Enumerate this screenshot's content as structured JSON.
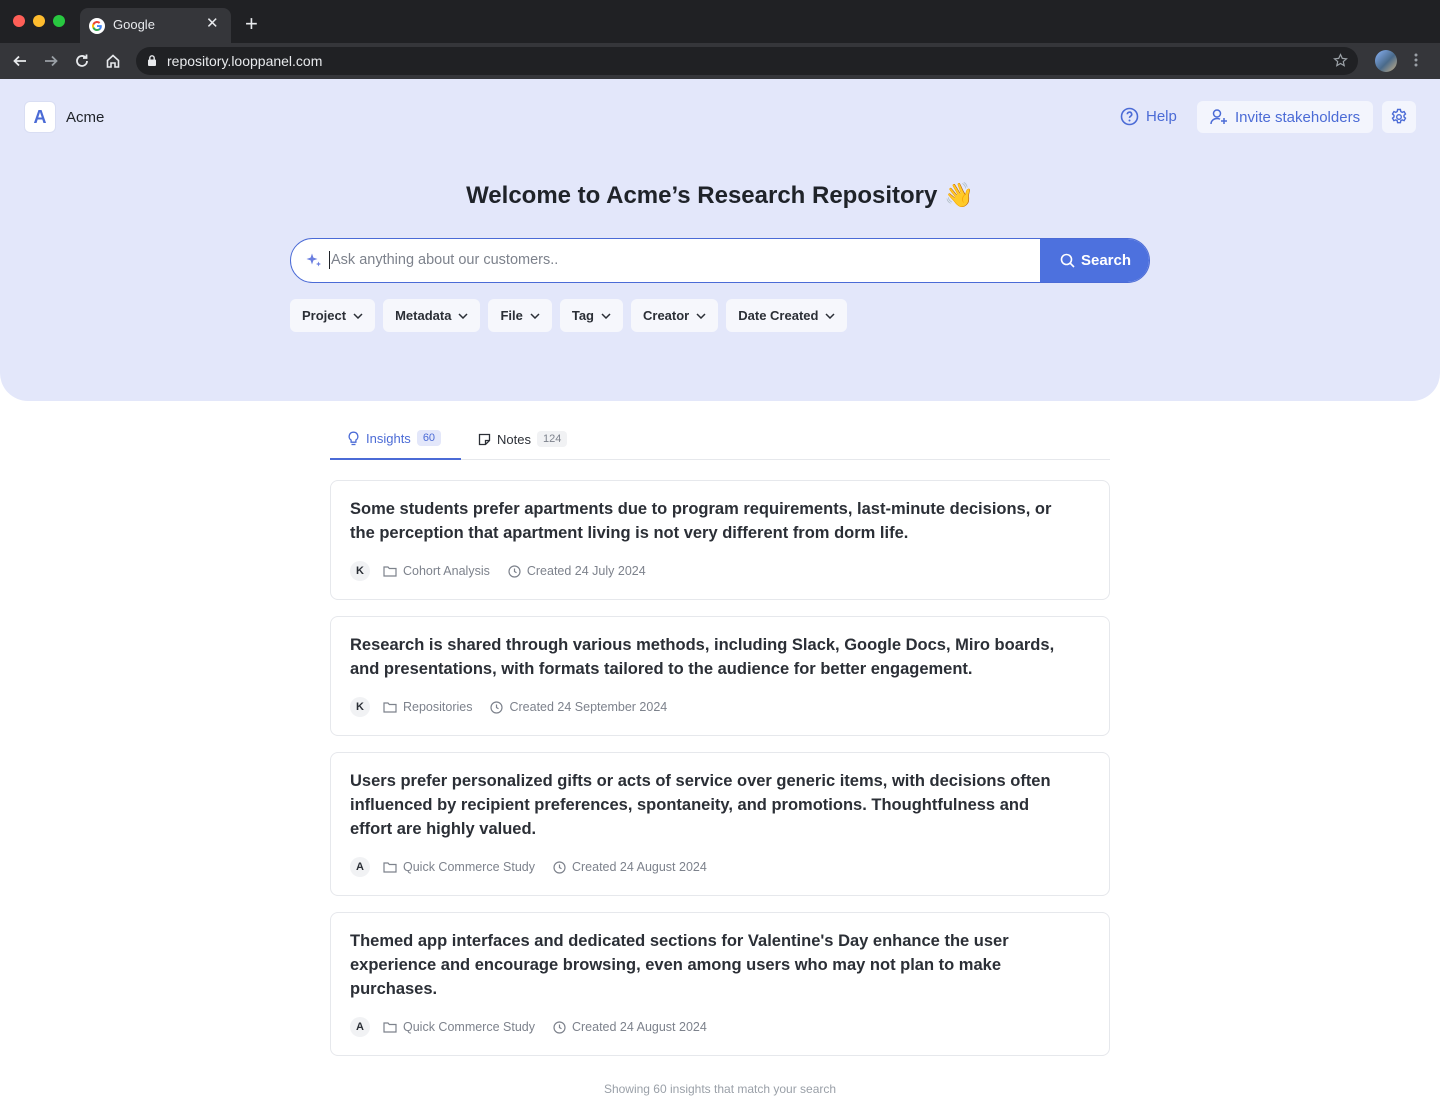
{
  "browser": {
    "tab_title": "Google",
    "url": "repository.looppanel.com"
  },
  "header": {
    "logo_letter": "A",
    "workspace_name": "Acme",
    "help_label": "Help",
    "invite_label": "Invite stakeholders"
  },
  "hero": {
    "title": "Welcome to Acme’s Research Repository 👋",
    "search_placeholder": "Ask anything about our customers..",
    "search_value": "",
    "search_button": "Search",
    "filters": [
      "Project",
      "Metadata",
      "File",
      "Tag",
      "Creator",
      "Date Created"
    ]
  },
  "tabs": [
    {
      "label": "Insights",
      "count": "60"
    },
    {
      "label": "Notes",
      "count": "124"
    }
  ],
  "insights": [
    {
      "text": "Some students prefer apartments due to program requirements, last-minute decisions, or the perception that apartment living is not very different from dorm life.",
      "author": "K",
      "project": "Cohort Analysis",
      "created": "Created 24 July 2024"
    },
    {
      "text": "Research is shared through various methods, including Slack, Google Docs, Miro boards, and presentations, with formats tailored to the audience for better engagement.",
      "author": "K",
      "project": "Repositories",
      "created": "Created 24 September 2024"
    },
    {
      "text": "Users prefer personalized gifts or acts of service over generic items, with decisions often influenced by recipient preferences, spontaneity, and promotions. Thoughtfulness and effort are highly valued.",
      "author": "A",
      "project": "Quick Commerce Study",
      "created": "Created 24 August 2024"
    },
    {
      "text": "Themed app interfaces and dedicated sections for Valentine's Day enhance the user experience and encourage browsing, even among users who may not plan to make purchases.",
      "author": "A",
      "project": "Quick Commerce Study",
      "created": "Created 24 August 2024"
    }
  ],
  "footer": "Showing 60 insights that match your search",
  "colors": {
    "accent": "#4b6bd6",
    "hero_bg": "#e3e7fa",
    "search_button_bg": "#4d71de"
  }
}
